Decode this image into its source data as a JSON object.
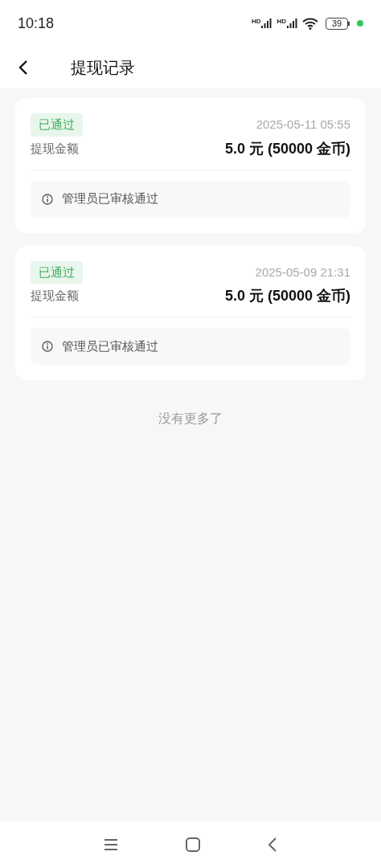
{
  "status_bar": {
    "time": "10:18",
    "sim_labels": [
      "HD",
      "HD"
    ],
    "battery": "39"
  },
  "header": {
    "title": "提现记录"
  },
  "records": [
    {
      "status": "已通过",
      "kind": "approved",
      "time": "2025-05-11 05:55",
      "amount_label": "提现金额",
      "amount": "5.0 元 (50000 金币)",
      "note": "管理员已审核通过"
    },
    {
      "status": "已通过",
      "kind": "approved",
      "time": "2025-05-09 21:31",
      "amount_label": "提现金额",
      "amount": "5.0 元 (50000 金币)",
      "note": "管理员已审核通过"
    }
  ],
  "end_text": "没有更多了"
}
